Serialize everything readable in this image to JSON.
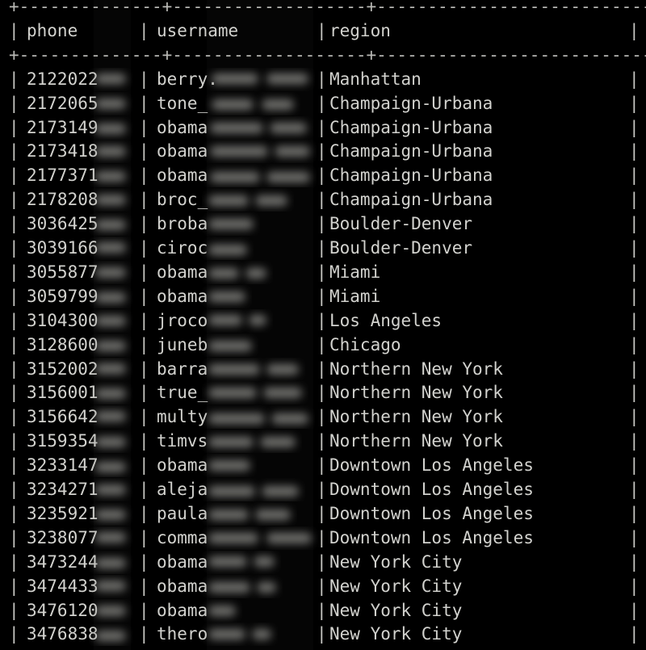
{
  "terminal": {
    "background_color": "#000000",
    "text_color": "#d2d2ce",
    "rule_color": "#b9b9b5"
  },
  "table": {
    "border_rule": "+--------------+-------------------+---------------------------+",
    "columns": [
      {
        "key": "phone",
        "header": "phone",
        "width_chars": 14
      },
      {
        "key": "username",
        "header": "username",
        "width_chars": 17
      },
      {
        "key": "region",
        "header": "region",
        "width_chars": 28
      }
    ],
    "redaction": {
      "style": "gaussian-blur",
      "note": "trailing characters of phone and username are blurred out"
    },
    "rows": [
      {
        "phone_visible": "2122022",
        "phone_redacted": true,
        "username_visible": "berry.",
        "username_redacted": true,
        "region": "Manhattan"
      },
      {
        "phone_visible": "2172065",
        "phone_redacted": true,
        "username_visible": "tone_",
        "username_redacted": true,
        "region": "Champaign-Urbana"
      },
      {
        "phone_visible": "2173149",
        "phone_redacted": true,
        "username_visible": "obama",
        "username_redacted": true,
        "region": "Champaign-Urbana"
      },
      {
        "phone_visible": "2173418",
        "phone_redacted": true,
        "username_visible": "obama",
        "username_redacted": true,
        "region": "Champaign-Urbana"
      },
      {
        "phone_visible": "2177371",
        "phone_redacted": true,
        "username_visible": "obama",
        "username_redacted": true,
        "region": "Champaign-Urbana"
      },
      {
        "phone_visible": "2178208",
        "phone_redacted": true,
        "username_visible": "broc_",
        "username_redacted": true,
        "region": "Champaign-Urbana"
      },
      {
        "phone_visible": "3036425",
        "phone_redacted": true,
        "username_visible": "broba",
        "username_redacted": true,
        "region": "Boulder-Denver"
      },
      {
        "phone_visible": "3039166",
        "phone_redacted": true,
        "username_visible": "ciroc",
        "username_redacted": true,
        "region": "Boulder-Denver"
      },
      {
        "phone_visible": "3055877",
        "phone_redacted": true,
        "username_visible": "obama",
        "username_redacted": true,
        "region": "Miami"
      },
      {
        "phone_visible": "3059799",
        "phone_redacted": true,
        "username_visible": "obama",
        "username_redacted": true,
        "region": "Miami"
      },
      {
        "phone_visible": "3104300",
        "phone_redacted": true,
        "username_visible": "jroco",
        "username_redacted": true,
        "region": "Los Angeles"
      },
      {
        "phone_visible": "3128600",
        "phone_redacted": true,
        "username_visible": "juneb",
        "username_redacted": true,
        "region": "Chicago"
      },
      {
        "phone_visible": "3152002",
        "phone_redacted": true,
        "username_visible": "barra",
        "username_redacted": true,
        "region": "Northern New York"
      },
      {
        "phone_visible": "3156001",
        "phone_redacted": true,
        "username_visible": "true_",
        "username_redacted": true,
        "region": "Northern New York"
      },
      {
        "phone_visible": "3156642",
        "phone_redacted": true,
        "username_visible": "multy",
        "username_redacted": true,
        "region": "Northern New York"
      },
      {
        "phone_visible": "3159354",
        "phone_redacted": true,
        "username_visible": "timvs",
        "username_redacted": true,
        "region": "Northern New York"
      },
      {
        "phone_visible": "3233147",
        "phone_redacted": true,
        "username_visible": "obama",
        "username_redacted": true,
        "region": "Downtown Los Angeles"
      },
      {
        "phone_visible": "3234271",
        "phone_redacted": true,
        "username_visible": "aleja",
        "username_redacted": true,
        "region": "Downtown Los Angeles"
      },
      {
        "phone_visible": "3235921",
        "phone_redacted": true,
        "username_visible": "paula",
        "username_redacted": true,
        "region": "Downtown Los Angeles"
      },
      {
        "phone_visible": "3238077",
        "phone_redacted": true,
        "username_visible": "comma",
        "username_redacted": true,
        "region": "Downtown Los Angeles"
      },
      {
        "phone_visible": "3473244",
        "phone_redacted": true,
        "username_visible": "obama",
        "username_redacted": true,
        "region": "New York City"
      },
      {
        "phone_visible": "3474433",
        "phone_redacted": true,
        "username_visible": "obama",
        "username_redacted": true,
        "region": "New York City"
      },
      {
        "phone_visible": "3476120",
        "phone_redacted": true,
        "username_visible": "obama",
        "username_redacted": true,
        "region": "New York City"
      },
      {
        "phone_visible": "3476838",
        "phone_redacted": true,
        "username_visible": "thero",
        "username_redacted": true,
        "region": "New York City"
      }
    ]
  }
}
